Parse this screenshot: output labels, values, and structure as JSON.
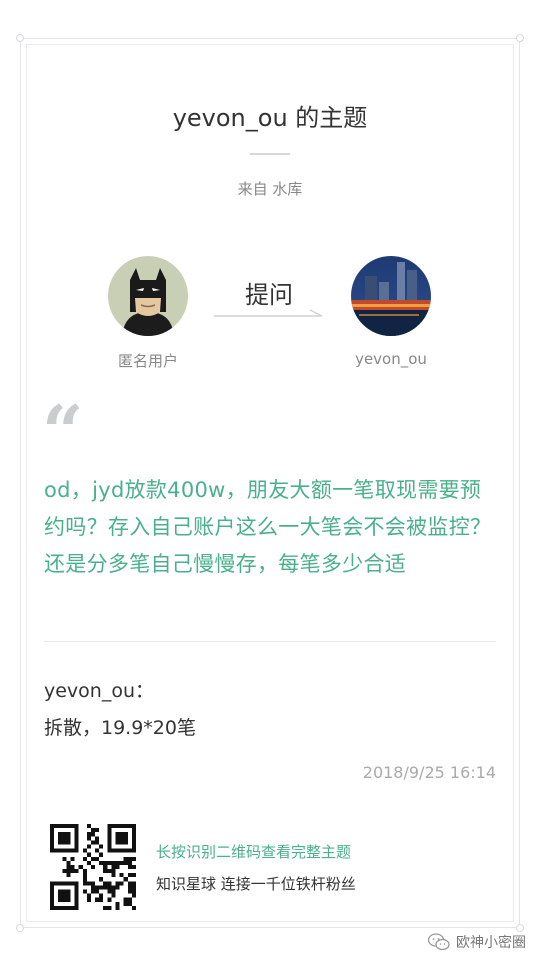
{
  "card": {
    "title": "yevon_ou 的主题",
    "from_label": "来自 水库"
  },
  "ask": {
    "asker_name": "匿名用户",
    "action_label": "提问",
    "responder_name": "yevon_ou"
  },
  "question": {
    "text": "od，jyd放款400w，朋友大额一笔取现需要预约吗？存入自己账户这么一大笔会不会被监控？还是分多笔自己慢慢存，每笔多少合适"
  },
  "answer": {
    "author": "yevon_ou：",
    "text": "拆散，19.9*20笔",
    "timestamp": "2018/9/25 16:14"
  },
  "footer": {
    "qr_hint": "长按识别二维码查看完整主题",
    "tagline": "知识星球 连接一千位铁杆粉丝"
  },
  "watermark": {
    "icon": "wechat-icon",
    "label": "欧神小密圈"
  },
  "colors": {
    "accent": "#49b189",
    "muted": "#888888"
  }
}
